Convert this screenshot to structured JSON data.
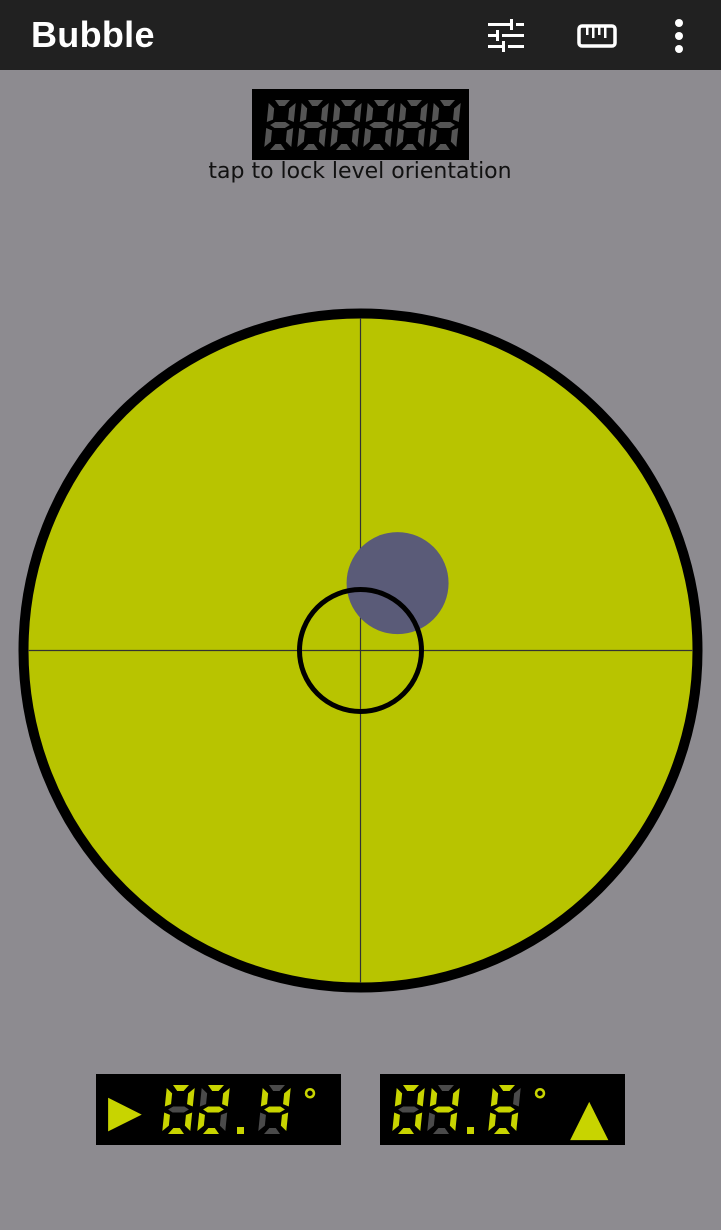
{
  "app_bar": {
    "title": "Bubble",
    "actions": [
      {
        "name": "tune-icon"
      },
      {
        "name": "ruler-icon"
      },
      {
        "name": "more-vert-icon"
      }
    ]
  },
  "lock": {
    "display": "888888",
    "hint": "tap to lock level orientation"
  },
  "level": {
    "bubble": {
      "dx": 0.11,
      "dy": -0.2
    }
  },
  "readouts": [
    {
      "indicator": "▶",
      "value": "02.4",
      "unit": "°"
    },
    {
      "value": "04.6",
      "unit": "°",
      "indicator": "▲"
    }
  ],
  "colors": {
    "background": "#8d8b90",
    "app_bar": "#212121",
    "level_face": "#b8c400",
    "bubble": "#5a5b78",
    "segment_on": "#c8d400",
    "segment_off": "#4a4a4a"
  }
}
